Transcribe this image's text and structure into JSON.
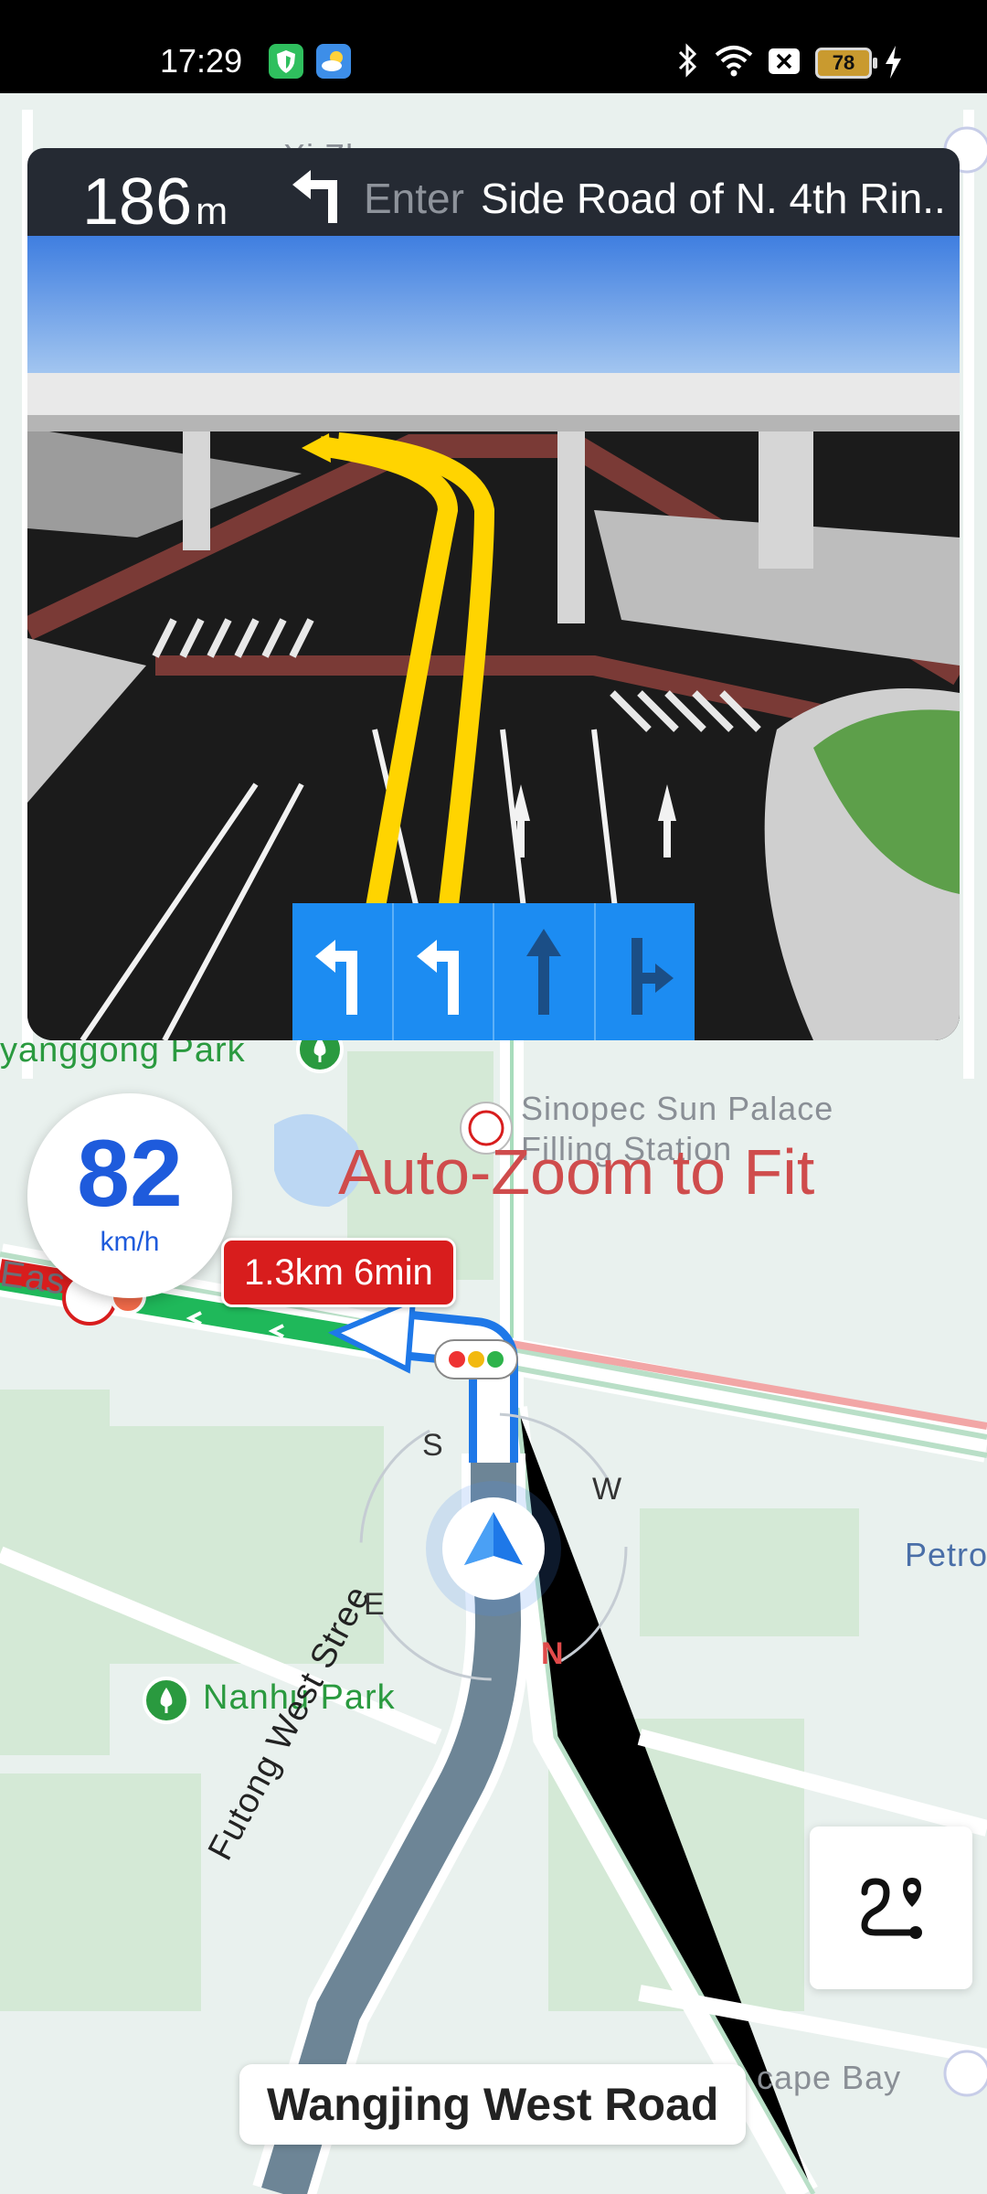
{
  "status_bar": {
    "time": "17:29",
    "battery": "78",
    "icons": [
      "shield-app-icon",
      "weather-app-icon",
      "bluetooth-icon",
      "wifi-icon",
      "sim-disabled-icon",
      "battery-icon",
      "charging-icon"
    ]
  },
  "guidance": {
    "distance_value": "186",
    "distance_unit": "m",
    "maneuver_icon": "turn-left-icon",
    "action": "Enter",
    "road": "Side Road of N. 4th Rin..."
  },
  "lanes": [
    {
      "icon": "left-turn-lane-icon",
      "recommended": true
    },
    {
      "icon": "left-turn-lane-icon",
      "recommended": true
    },
    {
      "icon": "straight-lane-icon",
      "recommended": false
    },
    {
      "icon": "straight-right-lane-icon",
      "recommended": false
    }
  ],
  "speed": {
    "value": "82",
    "unit": "km/h"
  },
  "eta": {
    "text": "1.3km 6min"
  },
  "overlay_text": "Auto-Zoom to Fit",
  "map_labels": {
    "sinopec_line1": "Sinopec Sun Palace",
    "sinopec_line2": "Filling Station",
    "park_top": "yanggong Park",
    "nanhu_park": "Nanhu Park",
    "street": "Futong West Stree",
    "petro_partial": "Petro",
    "bay_partial": "cape Bay",
    "east_partial": "Eas",
    "top_partial": "Xi  Zh"
  },
  "compass": {
    "n": "N",
    "s": "S",
    "e": "E",
    "w": "W"
  },
  "current_road": "Wangjing West Road",
  "colors": {
    "banner_bg": "#252a33",
    "lane_blue": "#1c8cf2",
    "speed_blue": "#1e5bdc",
    "route_green": "#1fb85a",
    "congestion_red": "#d81d1d"
  }
}
